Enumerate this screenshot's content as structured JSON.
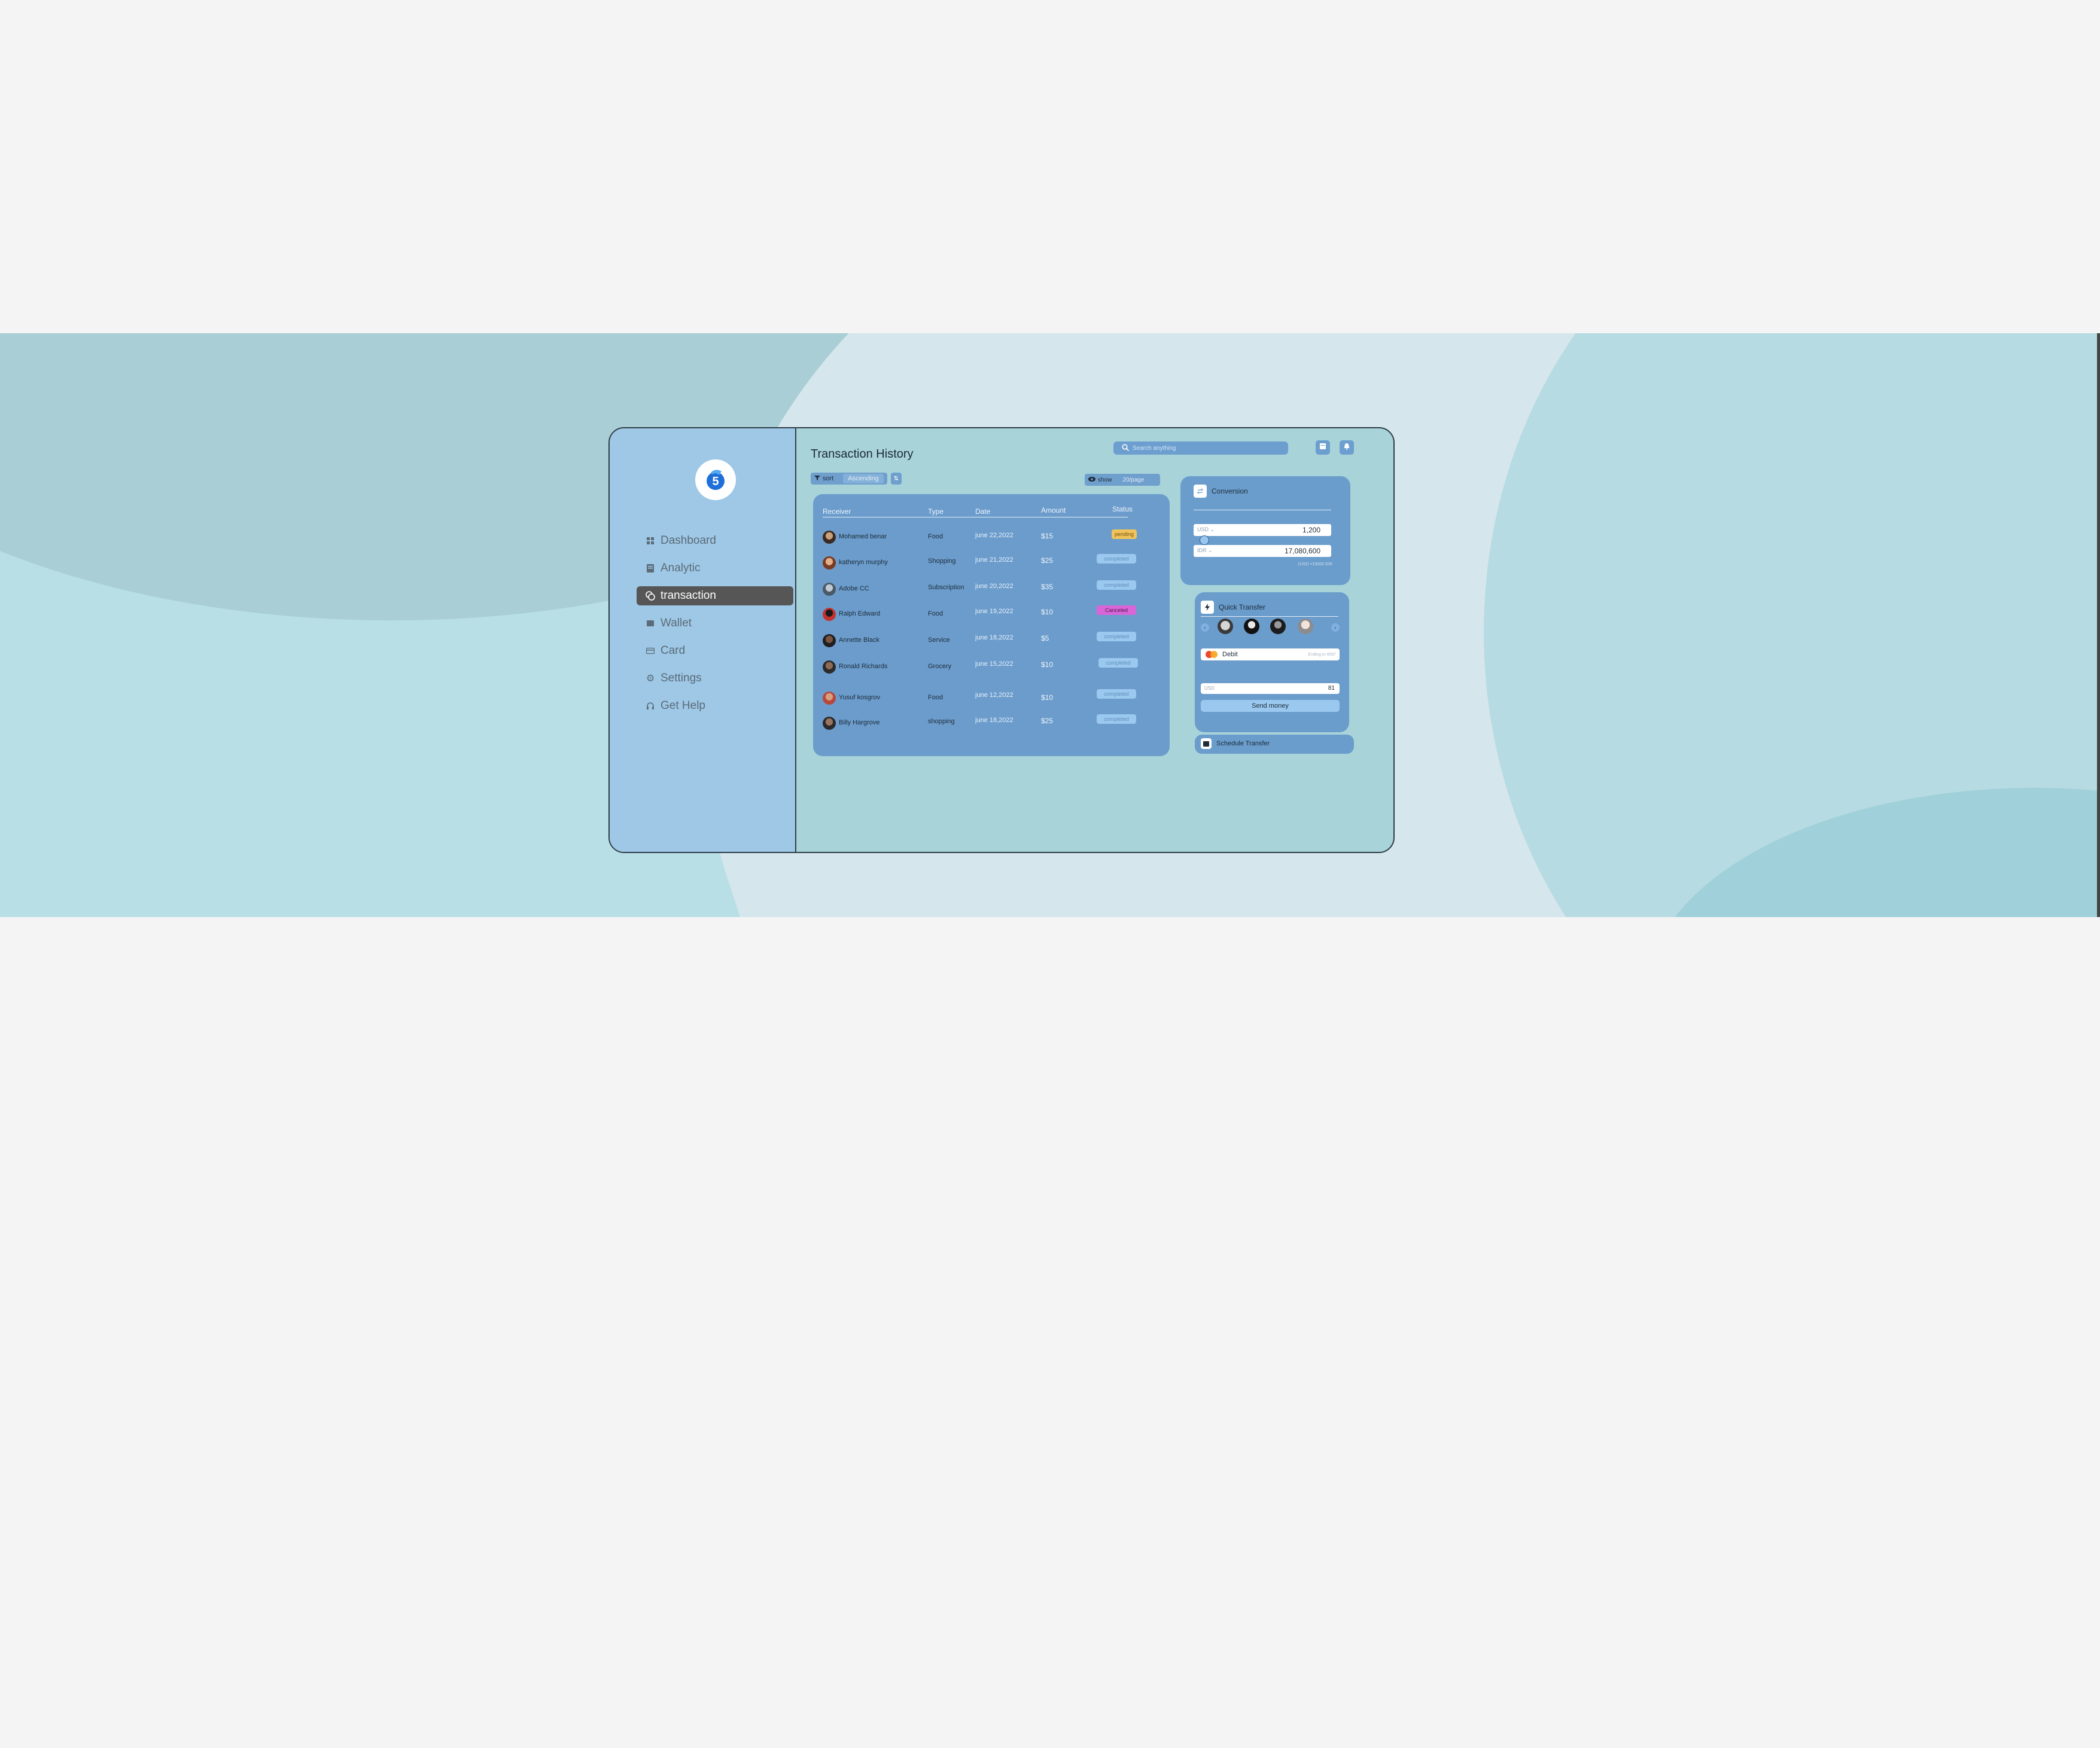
{
  "sidebar": {
    "items": [
      {
        "label": "Dashboard",
        "icon": "grid-icon"
      },
      {
        "label": "Analytic",
        "icon": "chart-icon"
      },
      {
        "label": "transaction",
        "icon": "transaction-icon",
        "active": true
      },
      {
        "label": "Wallet",
        "icon": "wallet-icon"
      },
      {
        "label": "Card",
        "icon": "card-icon"
      },
      {
        "label": "Settings",
        "icon": "gear-icon"
      },
      {
        "label": "Get Help",
        "icon": "headset-icon"
      }
    ]
  },
  "header": {
    "title": "Transaction History",
    "search_placeholder": "Search anything"
  },
  "toolbar": {
    "sort_label": "sort",
    "sort_value": "Ascending",
    "show_label": "show",
    "per_page": "20/page"
  },
  "table": {
    "columns": [
      "Receiver",
      "Type",
      "Date",
      "Amount",
      "Status"
    ],
    "rows": [
      {
        "receiver": "Mohamed benar",
        "type": "Food",
        "date": "june 22,2022",
        "amount": "$15",
        "status": "pending"
      },
      {
        "receiver": "katheryn murphy",
        "type": "Shopping",
        "date": "june 21,2022",
        "amount": "$25",
        "status": "completed"
      },
      {
        "receiver": "Adobe CC",
        "type": "Subscription",
        "date": "june 20,2022",
        "amount": "$35",
        "status": "completed"
      },
      {
        "receiver": "Ralph Edward",
        "type": "Food",
        "date": "june 19,2022",
        "amount": "$10",
        "status": "Canceled"
      },
      {
        "receiver": "Annette Black",
        "type": "Service",
        "date": "june 18,2022",
        "amount": "$5",
        "status": "completed"
      },
      {
        "receiver": "Ronald Richards",
        "type": "Grocery",
        "date": "june 15,2022",
        "amount": "$10",
        "status": "completed"
      },
      {
        "receiver": "Yusuf kosgrov",
        "type": "Food",
        "date": "june 12,2022",
        "amount": "$10",
        "status": "completed"
      },
      {
        "receiver": "Billy Hargrove",
        "type": "shopping",
        "date": "june 18,2022",
        "amount": "$25",
        "status": "completed"
      }
    ]
  },
  "conversion": {
    "title": "Conversion",
    "from_currency": "USD",
    "from_value": "1,200",
    "to_currency": "IDR",
    "to_value": "17,080,600",
    "rate_note": "1USD =15000 IDR"
  },
  "quick_transfer": {
    "title": "Quick Transfer",
    "card_label": "Debit",
    "card_hint": "Ending in 4567",
    "amount_currency": "USD",
    "amount_value": "81",
    "send_label": "Send money"
  },
  "schedule": {
    "title": "Schedule Transfer"
  },
  "colors": {
    "pending": "#f2c35a",
    "completed": "#9ac8ef",
    "canceled": "#d966d8",
    "accent": "#6b9ccc",
    "sidebar": "#9ec8e6"
  }
}
